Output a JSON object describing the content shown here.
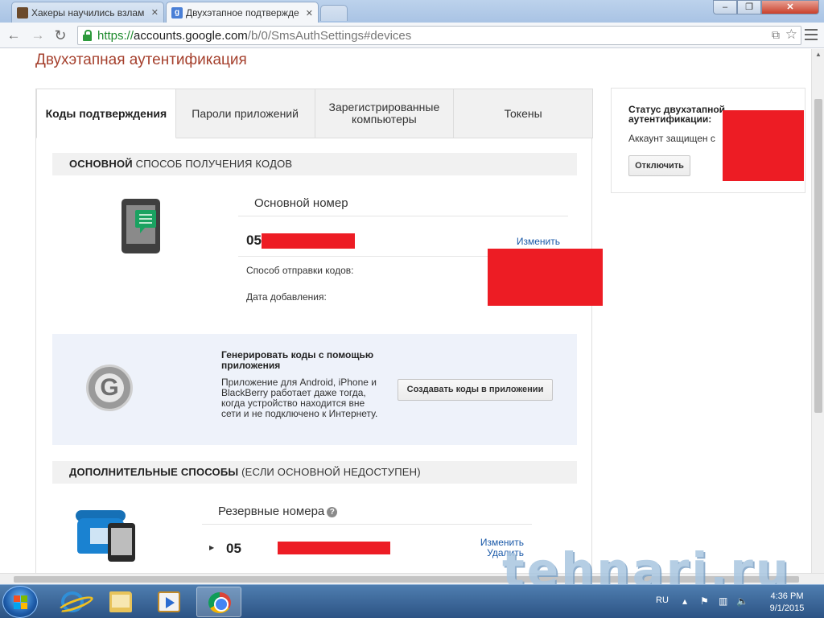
{
  "browser": {
    "tabs": [
      {
        "title": "Хакеры научились взлам",
        "favicon": "site-favicon"
      },
      {
        "title": "Двухэтапное подтвержде",
        "favicon": "google-favicon"
      }
    ],
    "url_scheme": "https://",
    "url_host": "accounts.google.com",
    "url_path": "/b/0/SmsAuthSettings#devices"
  },
  "page": {
    "title": "Двухэтапная аутентификация",
    "tabs": [
      {
        "label": "Коды подтверждения",
        "active": true
      },
      {
        "label": "Пароли приложений",
        "active": false
      },
      {
        "label": "Зарегистрированные компьютеры",
        "active": false
      },
      {
        "label": "Токены",
        "active": false
      }
    ],
    "primary": {
      "head_bold": "ОСНОВНОЙ",
      "head_rest": "СПОСОБ ПОЛУЧЕНИЯ КОДОВ",
      "label": "Основной номер",
      "number_prefix": "05",
      "change_link": "Изменить",
      "send_method_label": "Способ отправки кодов:",
      "added_date_label": "Дата добавления:"
    },
    "generator": {
      "title": "Генерировать коды с помощью приложения",
      "description": "Приложение для Android, iPhone и BlackBerry работает даже тогда, когда устройство находится вне сети и не подключено к Интернету.",
      "button": "Создавать коды в приложении"
    },
    "additional": {
      "head_bold": "ДОПОЛНИТЕЛЬНЫЕ СПОСОБЫ",
      "head_rest": "(ЕСЛИ ОСНОВНОЙ НЕДОСТУПЕН)",
      "label": "Резервные номера",
      "number_prefix": "05",
      "change_link": "Изменить",
      "delete_link": "Удалить"
    },
    "status": {
      "title": "Статус двухэтапной аутентификации:",
      "text": "Аккаунт защищен с",
      "button": "Отключить"
    },
    "watermark": "tehnari.ru"
  },
  "taskbar": {
    "lang": "RU",
    "time": "4:36 PM",
    "date": "9/1/2015"
  },
  "colors": {
    "title": "#a5402d",
    "link": "#1a59a8",
    "redaction": "#ed1c24",
    "generator_bg": "#eef2fa"
  }
}
